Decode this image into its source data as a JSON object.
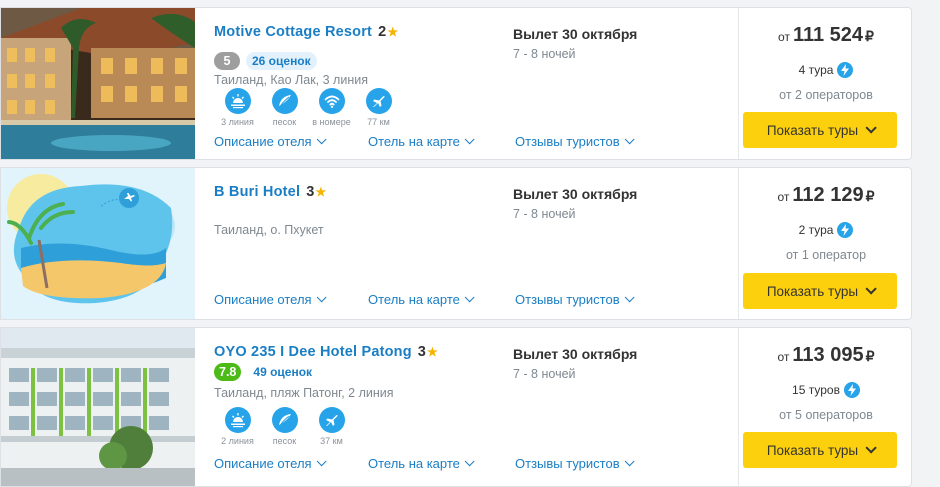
{
  "hotels": [
    {
      "name": "Motive Cottage Resort",
      "stars": "2",
      "rating": "5",
      "rating_color": "#9e9e9e",
      "reviews": "26 оценок",
      "location": "Таиланд, Као Лак, 3 линия",
      "amenities": [
        {
          "label": "3 линия",
          "icon": "sunrise-icon"
        },
        {
          "label": "песок",
          "icon": "sand-icon"
        },
        {
          "label": "в номере",
          "icon": "wifi-icon"
        },
        {
          "label": "77 км",
          "icon": "airplane-icon"
        }
      ],
      "links": {
        "description": "Описание отеля",
        "map": "Отель на карте",
        "reviews": "Отзывы туристов"
      },
      "departure": "Вылет 30 октября",
      "nights": "7 - 8 ночей",
      "price_from": "от",
      "price": "111 524",
      "currency": "₽",
      "tours": "4 тура",
      "operators": "от 2 операторов",
      "button": "Показать туры"
    },
    {
      "name": "B Buri Hotel",
      "stars": "3",
      "location": "Таиланд, о. Пхукет",
      "links": {
        "description": "Описание отеля",
        "map": "Отель на карте",
        "reviews": "Отзывы туристов"
      },
      "departure": "Вылет 30 октября",
      "nights": "7 - 8 ночей",
      "price_from": "от",
      "price": "112 129",
      "currency": "₽",
      "tours": "2 тура",
      "operators": "от 1 оператор",
      "button": "Показать туры"
    },
    {
      "name": "OYO 235 I Dee Hotel Patong",
      "stars": "3",
      "rating": "7.8",
      "rating_color": "#4cbb17",
      "reviews": "49 оценок",
      "location": "Таиланд, пляж Патонг, 2 линия",
      "amenities": [
        {
          "label": "2 линия",
          "icon": "sunrise-icon"
        },
        {
          "label": "песок",
          "icon": "sand-icon"
        },
        {
          "label": "37 км",
          "icon": "airplane-icon"
        }
      ],
      "links": {
        "description": "Описание отеля",
        "map": "Отель на карте",
        "reviews": "Отзывы туристов"
      },
      "departure": "Вылет 30 октября",
      "nights": "7 - 8 ночей",
      "price_from": "от",
      "price": "113 095",
      "currency": "₽",
      "tours": "15 туров",
      "operators": "от 5 операторов",
      "button": "Показать туры"
    }
  ]
}
